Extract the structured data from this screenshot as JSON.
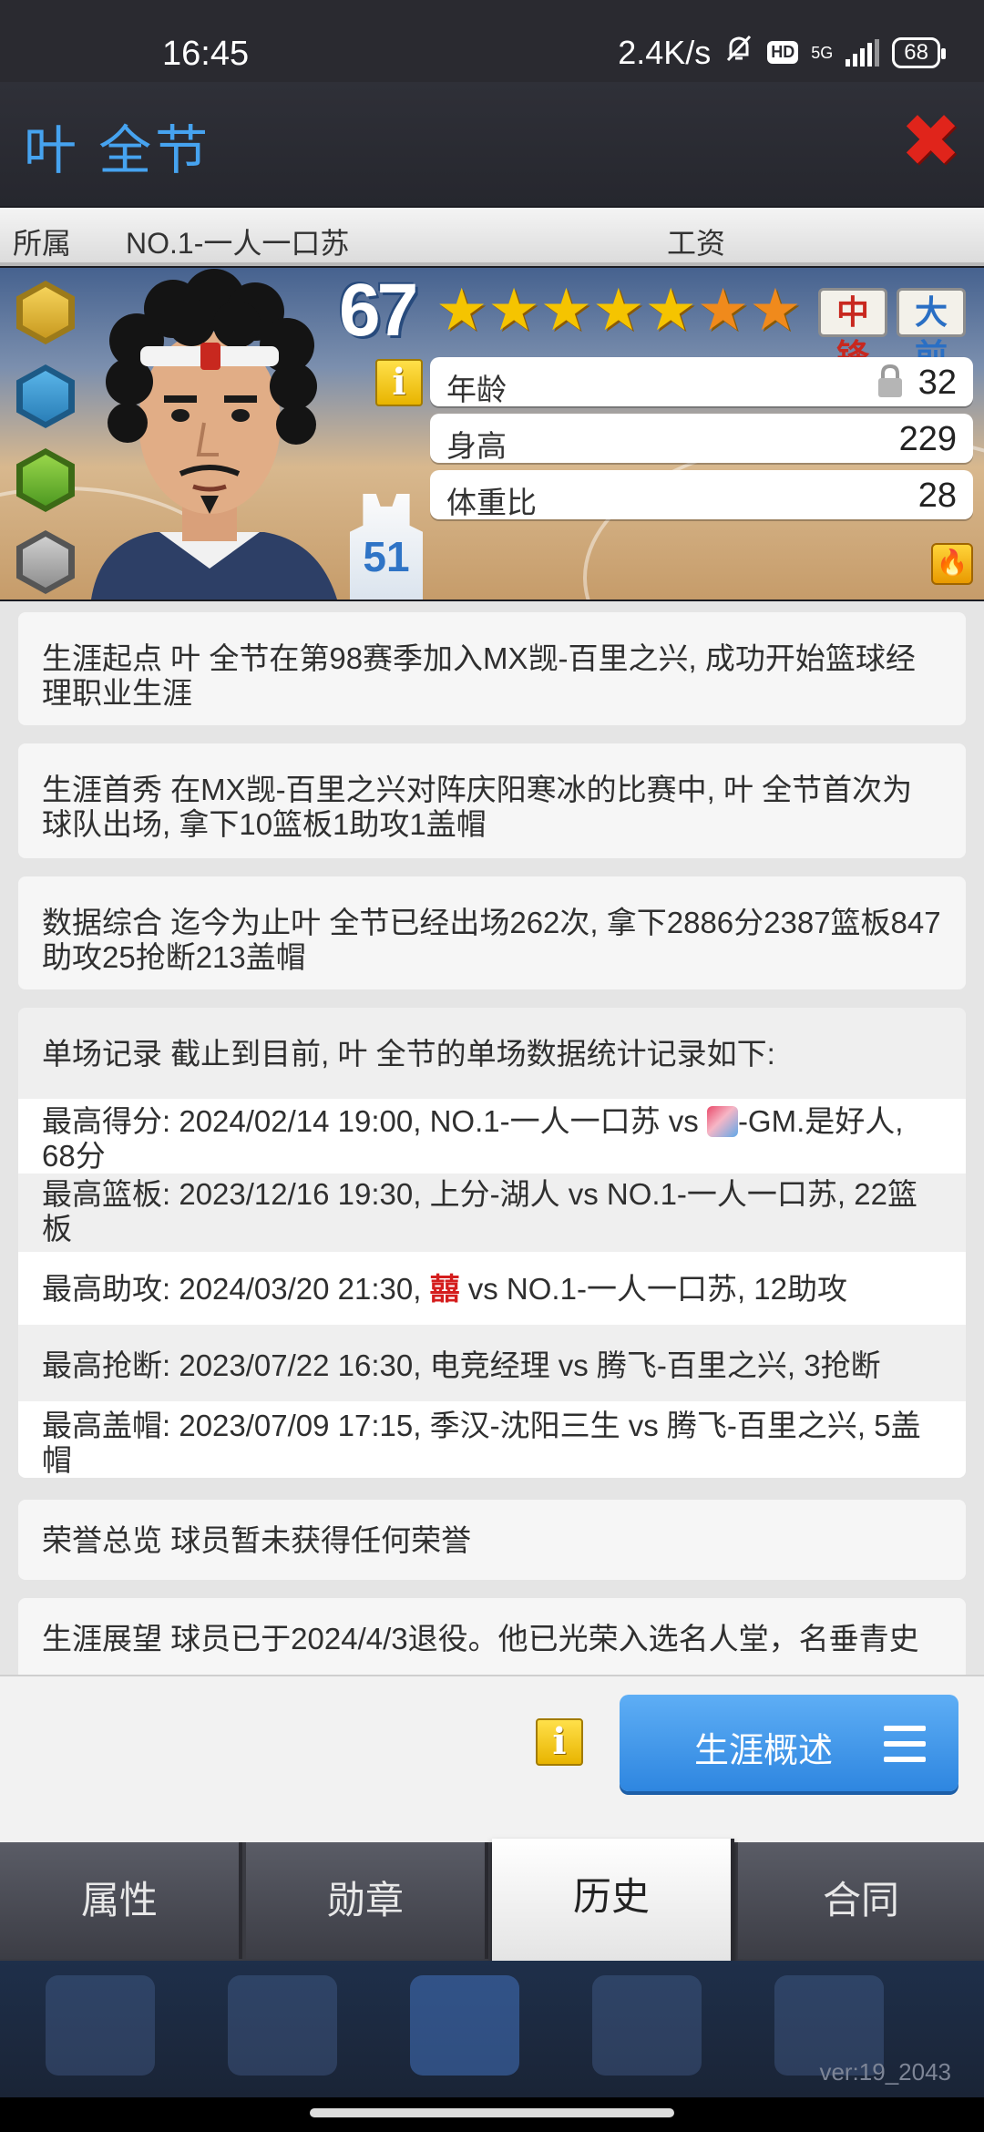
{
  "status_bar": {
    "time": "16:45",
    "net_speed": "2.4K/s",
    "hd": "HD",
    "network": "5G",
    "battery": "68"
  },
  "header": {
    "player_name": "叶 全节"
  },
  "affiliation": {
    "label": "所属",
    "team": "NO.1-一人一口苏",
    "salary_label": "工资"
  },
  "card": {
    "rating": "67",
    "positions": [
      {
        "label": "中锋",
        "color": "#c8281f"
      },
      {
        "label": "大前",
        "color": "#2a6fc4"
      }
    ],
    "stars_full": 5,
    "stars_orange": 2,
    "info_glyph": "i",
    "jersey_number": "51",
    "stats": [
      {
        "label": "年龄",
        "value": "32",
        "locked": true
      },
      {
        "label": "身高",
        "value": "229",
        "locked": false
      },
      {
        "label": "体重比",
        "value": "28",
        "locked": false
      }
    ],
    "badge_icons": [
      "player-gold-badge-icon",
      "player-blue-badge-icon",
      "player-green-badge-icon",
      "locked-badge-icon"
    ]
  },
  "history": {
    "career_start": "生涯起点 叶 全节在第98赛季加入MX觊-百里之兴, 成功开始篮球经理职业生涯",
    "debut": "生涯首秀 在MX觊-百里之兴对阵庆阳寒冰的比赛中, 叶 全节首次为球队出场, 拿下10篮板1助攻1盖帽",
    "summary": "数据综合 迄今为止叶 全节已经出场262次, 拿下2886分2387篮板847助攻25抢断213盖帽",
    "records_intro": "单场记录 截止到目前, 叶 全节的单场数据统计记录如下:",
    "records": {
      "points_before": "最高得分: 2024/02/14 19:00, NO.1-一人一口苏 vs ",
      "points_after": "-GM.是好人, 68分",
      "rebounds": "最高篮板: 2023/12/16 19:30, 上分-湖人 vs NO.1-一人一口苏, 22篮板",
      "assists_before": "最高助攻: 2024/03/20 21:30, ",
      "assists_red": "囍",
      "assists_after": " vs NO.1-一人一口苏, 12助攻",
      "steals": "最高抢断: 2023/07/22 16:30, 电竞经理 vs 腾飞-百里之兴, 3抢断",
      "blocks": "最高盖帽: 2023/07/09 17:15, 季汉-沈阳三生 vs 腾飞-百里之兴, 5盖帽"
    },
    "honors": "荣誉总览 球员暂未获得任何荣誉",
    "outlook": "生涯展望 球员已于2024/4/3退役。他已光荣入选名人堂，名垂青史"
  },
  "actions": {
    "info_glyph": "i",
    "career_overview": "生涯概述"
  },
  "tabs": [
    {
      "label": "属性",
      "active": false
    },
    {
      "label": "勋章",
      "active": false
    },
    {
      "label": "历史",
      "active": true
    },
    {
      "label": "合同",
      "active": false
    }
  ],
  "footer": {
    "version": "ver:19_2043"
  },
  "colors": {
    "accent_blue": "#46a3f0",
    "close_red": "#e0241b",
    "star_gold": "#f5c400",
    "star_orange": "#f08a1c"
  }
}
